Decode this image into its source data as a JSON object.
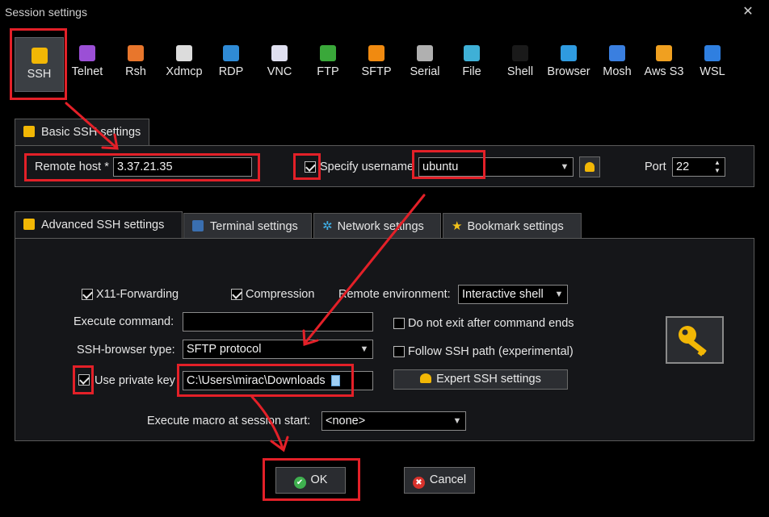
{
  "window": {
    "title": "Session settings",
    "close": "✕"
  },
  "session_types": [
    {
      "label": "SSH",
      "icon": "ssh-key-icon",
      "color": "#f2b705"
    },
    {
      "label": "Telnet",
      "icon": "telnet-icon",
      "color": "#9b4fd6"
    },
    {
      "label": "Rsh",
      "icon": "rsh-icon",
      "color": "#e8762c"
    },
    {
      "label": "Xdmcp",
      "icon": "xdmcp-icon",
      "color": "#dcdcdc"
    },
    {
      "label": "RDP",
      "icon": "rdp-icon",
      "color": "#2f8bd6"
    },
    {
      "label": "VNC",
      "icon": "vnc-icon",
      "color": "#e0e0f0"
    },
    {
      "label": "FTP",
      "icon": "ftp-icon",
      "color": "#3aa83a"
    },
    {
      "label": "SFTP",
      "icon": "sftp-icon",
      "color": "#f08a10"
    },
    {
      "label": "Serial",
      "icon": "serial-icon",
      "color": "#b0b0b0"
    },
    {
      "label": "File",
      "icon": "file-icon",
      "color": "#3fb0d6"
    },
    {
      "label": "Shell",
      "icon": "shell-icon",
      "color": "#1a1a1a"
    },
    {
      "label": "Browser",
      "icon": "browser-icon",
      "color": "#2f9be0"
    },
    {
      "label": "Mosh",
      "icon": "mosh-icon",
      "color": "#3a7fe0"
    },
    {
      "label": "Aws S3",
      "icon": "aws-s3-icon",
      "color": "#f0a020"
    },
    {
      "label": "WSL",
      "icon": "wsl-icon",
      "color": "#2f7fe0"
    }
  ],
  "basic": {
    "tab_label": "Basic SSH settings",
    "remote_host_label": "Remote host *",
    "remote_host_value": "3.37.21.35",
    "specify_username_label": "Specify username",
    "specify_username_checked": true,
    "username_value": "ubuntu",
    "port_label": "Port",
    "port_value": "22"
  },
  "tabs": {
    "advanced": "Advanced SSH settings",
    "terminal": "Terminal settings",
    "network": "Network settings",
    "bookmark": "Bookmark settings"
  },
  "advanced": {
    "x11_label": "X11-Forwarding",
    "x11_checked": true,
    "compression_label": "Compression",
    "compression_checked": true,
    "remote_env_label": "Remote environment:",
    "remote_env_value": "Interactive shell",
    "execute_command_label": "Execute command:",
    "execute_command_value": "",
    "do_not_exit_label": "Do not exit after command ends",
    "do_not_exit_checked": false,
    "ssh_browser_label": "SSH-browser type:",
    "ssh_browser_value": "SFTP protocol",
    "follow_ssh_label": "Follow SSH path (experimental)",
    "follow_ssh_checked": false,
    "use_private_key_label": "Use private key",
    "use_private_key_checked": true,
    "private_key_value": "C:\\Users\\mirac\\Downloads",
    "expert_button": "Expert SSH settings",
    "execute_macro_label": "Execute macro at session start:",
    "execute_macro_value": "<none>"
  },
  "buttons": {
    "ok": "OK",
    "cancel": "Cancel"
  },
  "colors": {
    "annotation_red": "#e32028",
    "ok_green": "#3fb04f",
    "cancel_red": "#d8322c",
    "key_gold": "#f2b705"
  }
}
